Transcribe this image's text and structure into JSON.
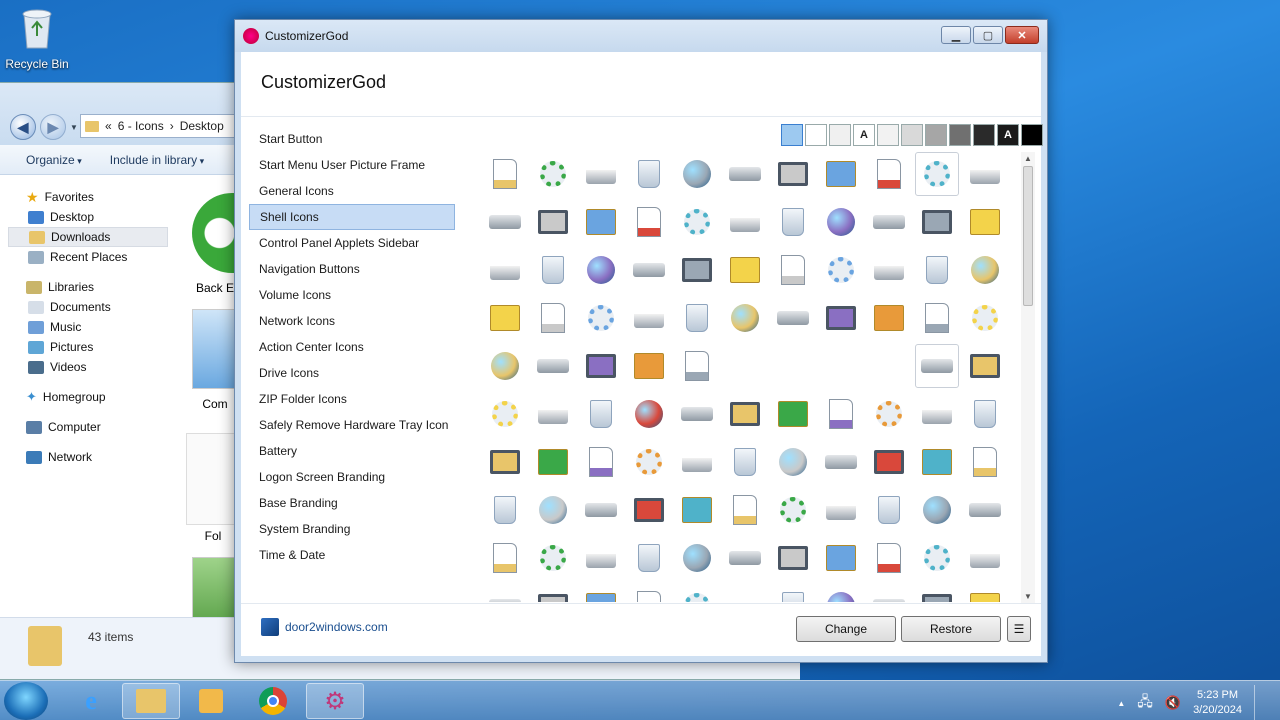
{
  "desktop": {
    "recycle_bin_label": "Recycle Bin"
  },
  "explorer": {
    "breadcrumb": [
      "«",
      "6 - Icons",
      "›",
      "Desktop"
    ],
    "toolbar": {
      "organize": "Organize",
      "include": "Include in library"
    },
    "sidebar": {
      "favorites": "Favorites",
      "favorites_items": [
        "Desktop",
        "Downloads",
        "Recent Places"
      ],
      "libraries": "Libraries",
      "libraries_items": [
        "Documents",
        "Music",
        "Pictures",
        "Videos"
      ],
      "homegroup": "Homegroup",
      "computer": "Computer",
      "network": "Network"
    },
    "content_labels": [
      "Back E",
      "Com",
      "Fol"
    ],
    "status": "43 items"
  },
  "dialog": {
    "window_title": "CustomizerGod",
    "header_title": "CustomizerGod",
    "menu": [
      "Start Button",
      "Start Menu User Picture Frame",
      "General Icons",
      "Shell Icons",
      "Control Panel Applets Sidebar",
      "Navigation Buttons",
      "Volume Icons",
      "Network Icons",
      "Action Center Icons",
      "Drive Icons",
      "ZIP Folder Icons",
      "Safely Remove Hardware Tray Icon",
      "Battery",
      "Logon Screen Branding",
      "Base Branding",
      "System Branding",
      "Time & Date"
    ],
    "selected_menu": "Shell Icons",
    "swatches": [
      {
        "bg": "#9dc9f0",
        "label": ""
      },
      {
        "bg": "#ffffff",
        "label": ""
      },
      {
        "bg": "#f0f0f0",
        "label": ""
      },
      {
        "bg": "#ffffff",
        "label": "A"
      },
      {
        "bg": "#f2f2f2",
        "label": ""
      },
      {
        "bg": "#d9d9d9",
        "label": ""
      },
      {
        "bg": "#a6a6a6",
        "label": ""
      },
      {
        "bg": "#707070",
        "label": ""
      },
      {
        "bg": "#2a2a2a",
        "label": ""
      },
      {
        "bg": "#1a1a1a",
        "label": "A"
      },
      {
        "bg": "#000000",
        "label": ""
      }
    ],
    "brand_link": "door2windows.com",
    "change_button": "Change",
    "restore_button": "Restore",
    "menu_button": "☰"
  },
  "taskbar": {
    "time": "5:23 PM",
    "date": "3/20/2024",
    "tray_arrow": "▲"
  }
}
